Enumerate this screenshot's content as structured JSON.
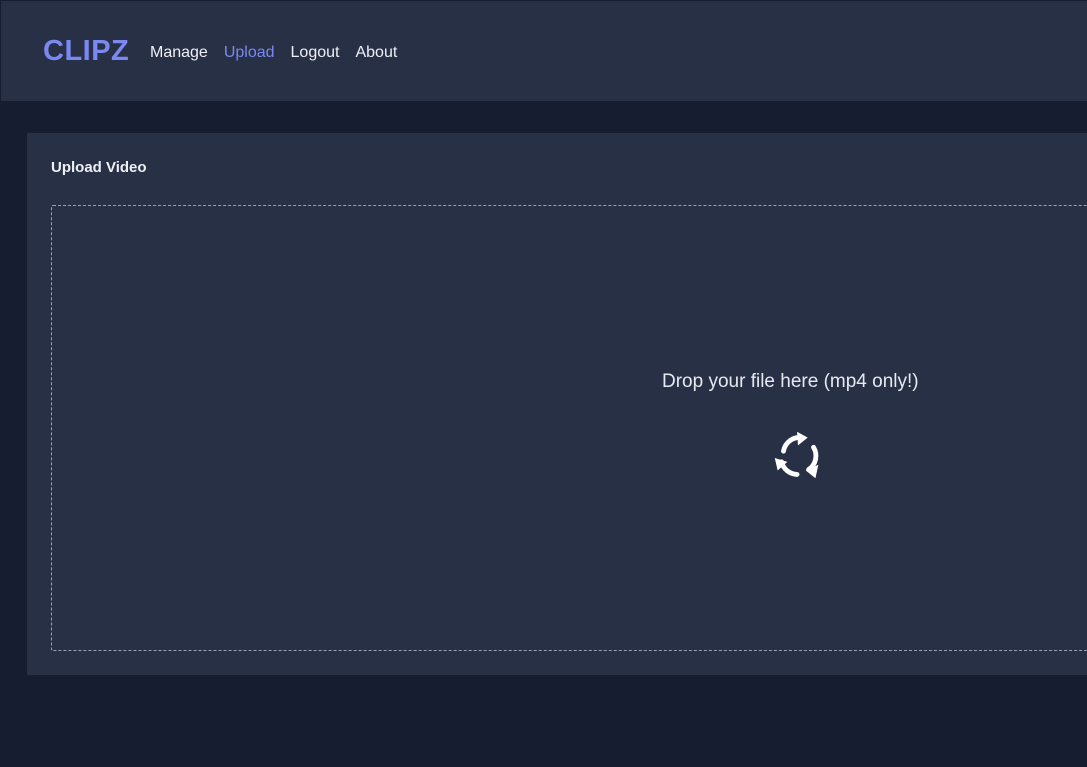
{
  "header": {
    "logo": "CLIPZ",
    "nav": {
      "manage": "Manage",
      "upload": "Upload",
      "logout": "Logout",
      "about": "About"
    },
    "active_item": "Upload"
  },
  "upload_card": {
    "title": "Upload Video",
    "dropzone": {
      "text": "Drop your file here (mp4 only!)",
      "icon": "refresh-icon"
    }
  },
  "colors": {
    "background": "#161d31",
    "panel": "#283046",
    "accent": "#7b88f2",
    "text": "#eef0f6"
  }
}
